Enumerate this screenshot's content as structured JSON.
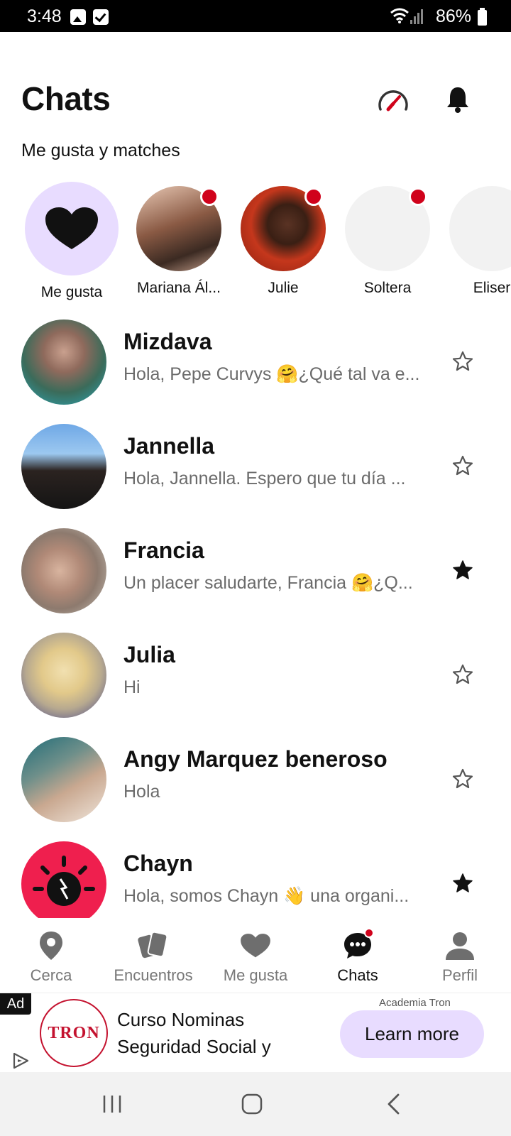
{
  "status_bar": {
    "time": "3:48",
    "battery": "86%"
  },
  "header": {
    "title": "Chats"
  },
  "matches": {
    "section_title": "Me gusta y matches",
    "likes_label": "Me gusta",
    "items": [
      {
        "name": "Mariana Ál...",
        "unread": true
      },
      {
        "name": "Julie",
        "unread": true
      },
      {
        "name": "Soltera",
        "unread": true
      },
      {
        "name": "Eliser",
        "unread": false
      }
    ]
  },
  "chats": [
    {
      "name": "Mizdava",
      "preview": "Hola, Pepe Curvys 🤗¿Qué tal va e...",
      "starred": false
    },
    {
      "name": "Jannella",
      "preview": "Hola, Jannella. Espero que tu día ...",
      "starred": false
    },
    {
      "name": "Francia",
      "preview": "Un placer saludarte, Francia 🤗¿Q...",
      "starred": true
    },
    {
      "name": "Julia",
      "preview": "Hi",
      "starred": false
    },
    {
      "name": "Angy Marquez beneroso",
      "preview": "Hola",
      "starred": false
    },
    {
      "name": "Chayn",
      "preview": "Hola, somos Chayn 👋 una organi...",
      "starred": true
    }
  ],
  "bottom_nav": [
    {
      "label": "Cerca",
      "icon": "location-pin-icon",
      "active": false
    },
    {
      "label": "Encuentros",
      "icon": "cards-icon",
      "active": false
    },
    {
      "label": "Me gusta",
      "icon": "heart-icon",
      "active": false
    },
    {
      "label": "Chats",
      "icon": "chat-bubble-icon",
      "active": true
    },
    {
      "label": "Perfil",
      "icon": "profile-icon",
      "active": false
    }
  ],
  "ad": {
    "badge": "Ad",
    "advertiser": "Academia Tron",
    "title": "Curso Nominas Seguridad Social y",
    "cta": "Learn more",
    "logo_text": "TRON"
  },
  "colors": {
    "accent_red": "#d0021b",
    "lavender": "#e8dcff",
    "text_primary": "#111111",
    "text_secondary": "#6b6b6b"
  }
}
